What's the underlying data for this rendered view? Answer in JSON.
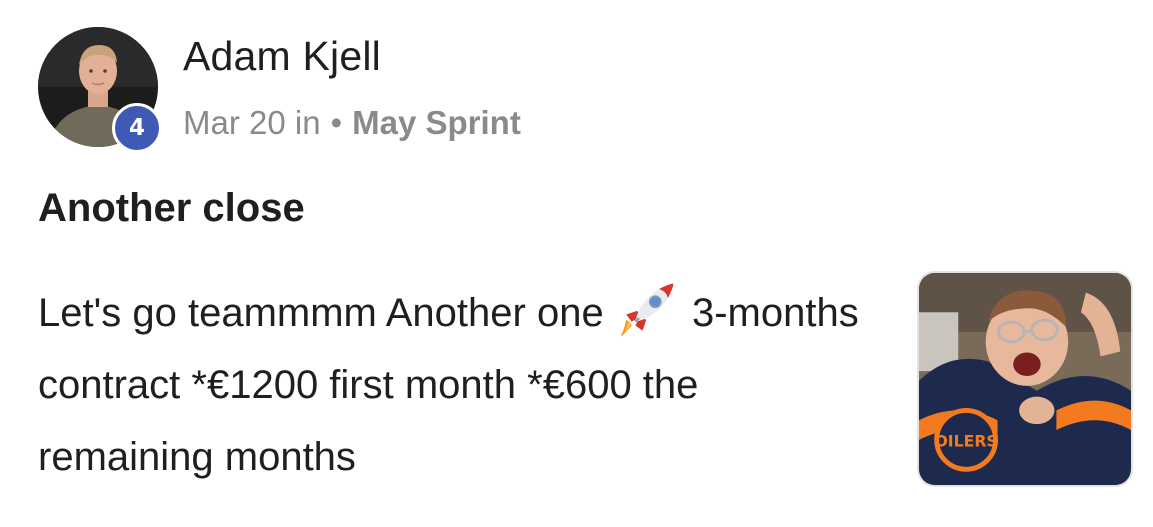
{
  "post": {
    "author": {
      "name": "Adam Kjell",
      "level": "4"
    },
    "meta": {
      "date": "Mar 20 in",
      "separator": "•",
      "category": "May Sprint"
    },
    "title": "Another close",
    "body": {
      "part1": "Let's go teammmm Another one",
      "emoji": "rocket-icon",
      "part2": "3-months contract *€1200 first month *€600 the remaining months"
    },
    "thumbnail": {
      "icon": "celebration-gif-thumbnail",
      "text": "OILERS"
    }
  },
  "colors": {
    "badge": "#3f5ab5",
    "text": "#1f1f1f",
    "muted": "#8a8a8a"
  }
}
